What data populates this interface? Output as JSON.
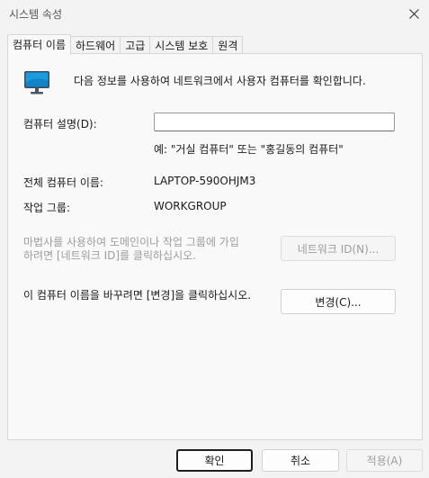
{
  "window": {
    "title": "시스템 속성"
  },
  "tabs": [
    {
      "label": "컴퓨터 이름",
      "active": true
    },
    {
      "label": "하드웨어",
      "active": false
    },
    {
      "label": "고급",
      "active": false
    },
    {
      "label": "시스템 보호",
      "active": false
    },
    {
      "label": "원격",
      "active": false
    }
  ],
  "computer_name_tab": {
    "intro": "다음 정보를 사용하여 네트워크에서 사용자 컴퓨터를 확인합니다.",
    "description_label": "컴퓨터 설명(D):",
    "description_value": "",
    "description_example": "예: \"거실 컴퓨터\" 또는 \"홍길동의 컴퓨터\"",
    "full_name_label": "전체 컴퓨터 이름:",
    "full_name_value": "LAPTOP-590OHJM3",
    "workgroup_label": "작업 그룹:",
    "workgroup_value": "WORKGROUP",
    "wizard_text": "마법사를 사용하여 도메인이나 작업 그룹에 가입하려면 [네트워크 ID]를 클릭하십시오.",
    "network_id_button": "네트워크 ID(N)...",
    "rename_text": "이 컴퓨터 이름을 바꾸려면 [변경]을 클릭하십시오.",
    "change_button": "변경(C)..."
  },
  "footer": {
    "ok": "확인",
    "cancel": "취소",
    "apply": "적용(A)"
  },
  "icons": {
    "close": "close-icon",
    "computer": "computer-monitor-icon"
  }
}
